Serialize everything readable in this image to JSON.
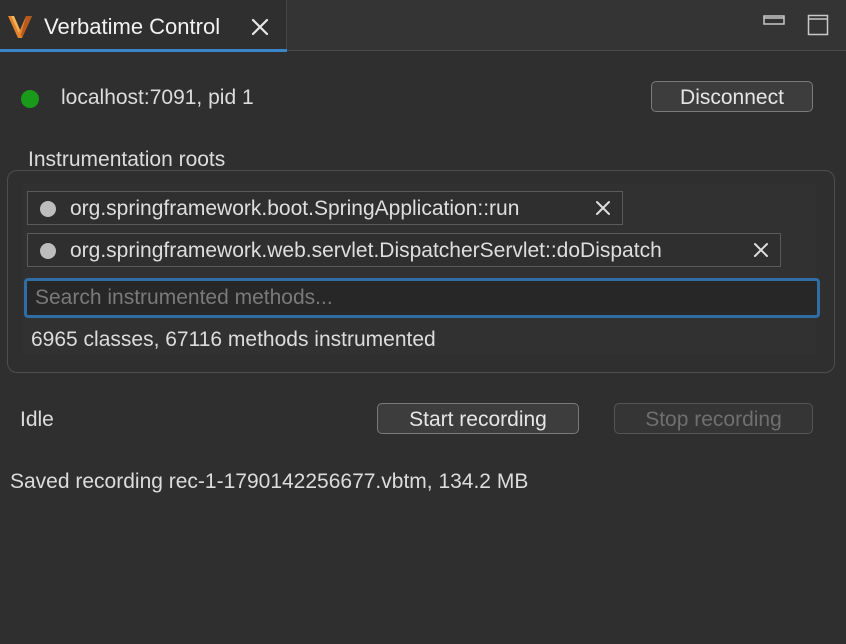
{
  "tab": {
    "title": "Verbatime Control",
    "icon": "verbatime-logo-icon"
  },
  "window_controls": {
    "minimize_icon": "minimize-icon",
    "maximize_icon": "maximize-icon"
  },
  "connection": {
    "status_color": "#1a9a1a",
    "label": "localhost:7091, pid 1",
    "disconnect_label": "Disconnect"
  },
  "roots": {
    "label": "Instrumentation roots",
    "items": [
      {
        "label": "org.springframework.boot.SpringApplication::run"
      },
      {
        "label": "org.springframework.web.servlet.DispatcherServlet::doDispatch"
      }
    ],
    "search_placeholder": "Search instrumented methods...",
    "search_value": "",
    "counts": "6965 classes, 67116 methods instrumented"
  },
  "recording": {
    "state": "Idle",
    "start_label": "Start recording",
    "stop_label": "Stop recording",
    "stop_enabled": false,
    "saved_message": "Saved recording rec-1-1790142256677.vbtm, 134.2 MB"
  },
  "colors": {
    "accent": "#3a86c8",
    "background": "#2f2f2f"
  }
}
